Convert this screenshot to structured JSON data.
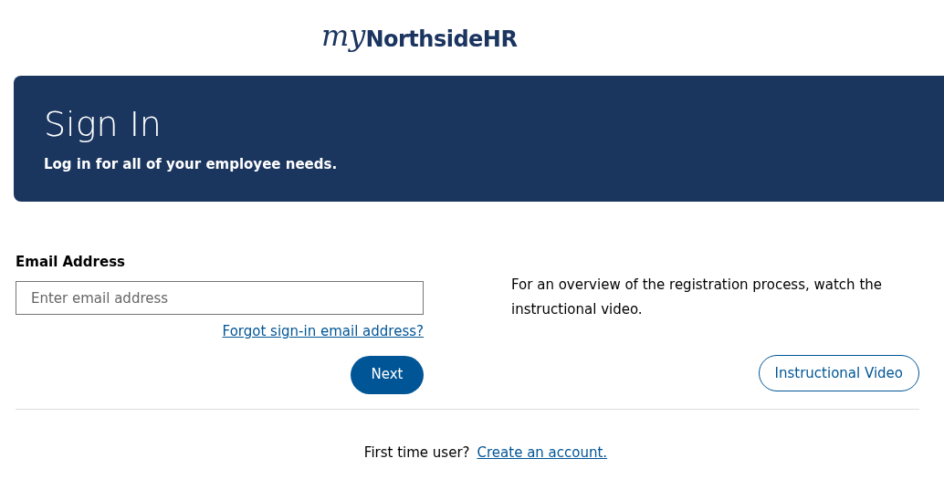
{
  "logo": {
    "prefix": "my",
    "name": "NorthsideHR"
  },
  "banner": {
    "title": "Sign In",
    "subtitle": "Log in for all of your employee needs."
  },
  "form": {
    "label": "Email Address",
    "placeholder": "Enter email address",
    "forgot_link": "Forgot sign-in email address?",
    "next_button": "Next"
  },
  "video": {
    "text": "For an overview of the registration process, watch the instructional video.",
    "button": "Instructional Video"
  },
  "footer": {
    "prompt": "First time user?",
    "link": "Create an account."
  }
}
